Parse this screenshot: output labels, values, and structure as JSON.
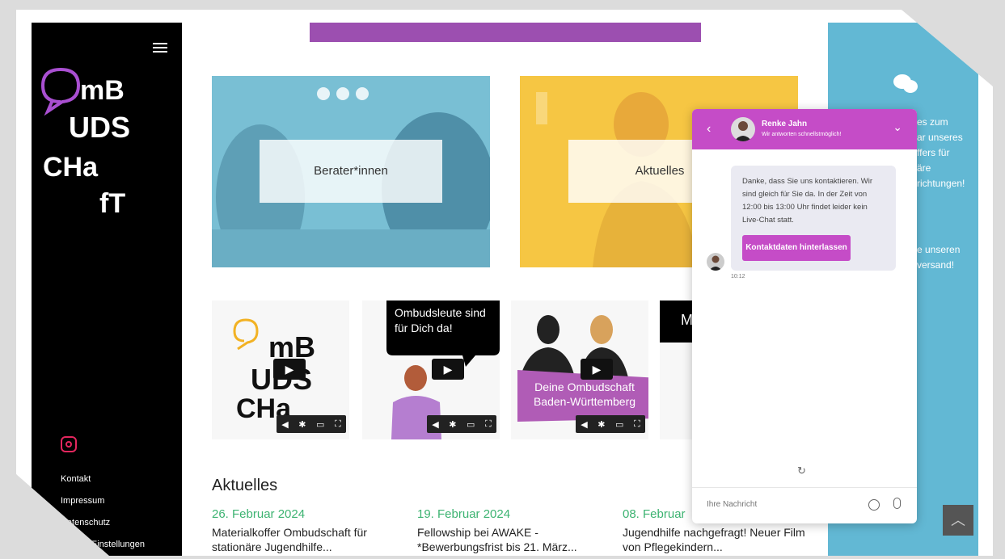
{
  "sidebar": {
    "logo_text": [
      "mB",
      "UDS",
      "CHa",
      "fT"
    ],
    "nav": [
      "Kontakt",
      "Impressum",
      "Datenschutz",
      "Cookie-Einstellungen"
    ]
  },
  "tiles": [
    {
      "label": "Berater*innen"
    },
    {
      "label": "Aktuelles"
    }
  ],
  "videos": [
    {
      "caption": ""
    },
    {
      "caption": "Ombudsleute sind für Dich da!"
    },
    {
      "caption": "Deine Ombudschaft Baden-Württemberg"
    },
    {
      "caption": "M"
    }
  ],
  "news": {
    "title": "Aktuelles",
    "items": [
      {
        "date": "26. Februar 2024",
        "title": "Materialkoffer Ombudschaft für stationäre Jugendhilfe..."
      },
      {
        "date": "19. Februar 2024",
        "title": "Fellowship bei AWAKE - *Bewerbungsfrist bis 21. März..."
      },
      {
        "date": "08. Februar",
        "title": "Jugendhilfe nachgefragt! Neuer Film von Pflegekindern..."
      }
    ]
  },
  "right_panel": {
    "lines1": [
      "es zum",
      "ar unseres",
      "ffers für",
      "äre",
      "richtungen!"
    ],
    "lines2": [
      "e unseren",
      "versand!"
    ]
  },
  "chat": {
    "agent_name": "Renke Jahn",
    "agent_status": "Wir antworten schnellstmöglich!",
    "message": "Danke, dass Sie uns kontaktieren. Wir sind gleich für Sie da. In der Zeit von 12:00 bis 13:00 Uhr findet leider kein Live-Chat statt.",
    "button": "Kontaktdaten hinterlassen",
    "time": "10:12",
    "input_placeholder": "Ihre Nachricht"
  },
  "colors": {
    "accent": "#c54cc7",
    "sidebar": "#000000",
    "blue_panel": "#62b8d4",
    "date_green": "#3cb371"
  }
}
